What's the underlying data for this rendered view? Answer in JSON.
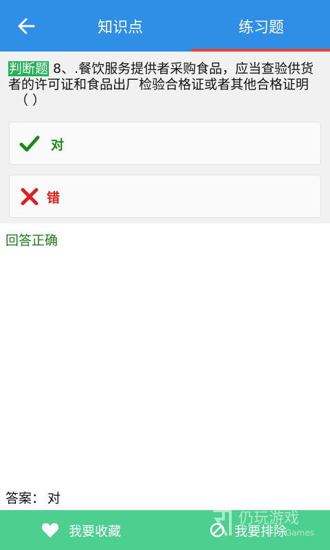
{
  "header": {
    "back_icon": "arrow-left-icon",
    "tabs": [
      {
        "label": "知识点",
        "active": false
      },
      {
        "label": "练习题",
        "active": true
      }
    ],
    "bg_color": "#2f8ee6",
    "active_indicator_color": "#e0463f"
  },
  "question": {
    "type_label": "判断题",
    "text": " 8、.餐饮服务提供者采购食品，应当查验供货者的许可证和食品出厂检验合格证或者其他合格证明",
    "blank": "（                    ）"
  },
  "options": [
    {
      "icon": "check-icon",
      "label": "对",
      "color": "#1a8a1a"
    },
    {
      "icon": "cross-icon",
      "label": "错",
      "color": "#e01e1e"
    }
  ],
  "result": {
    "text": "回答正确"
  },
  "answer": {
    "label": "答案",
    "colon": "：",
    "value": "对"
  },
  "bottom_bar": {
    "collect_label": "我要收藏",
    "collect_icon": "heart-icon",
    "exclude_label": "我要排除",
    "exclude_icon": "prohibit-icon",
    "bg_color": "#4dcf8f"
  },
  "watermark": {
    "text_cn": "仍玩游戏",
    "text_en": "Games"
  }
}
